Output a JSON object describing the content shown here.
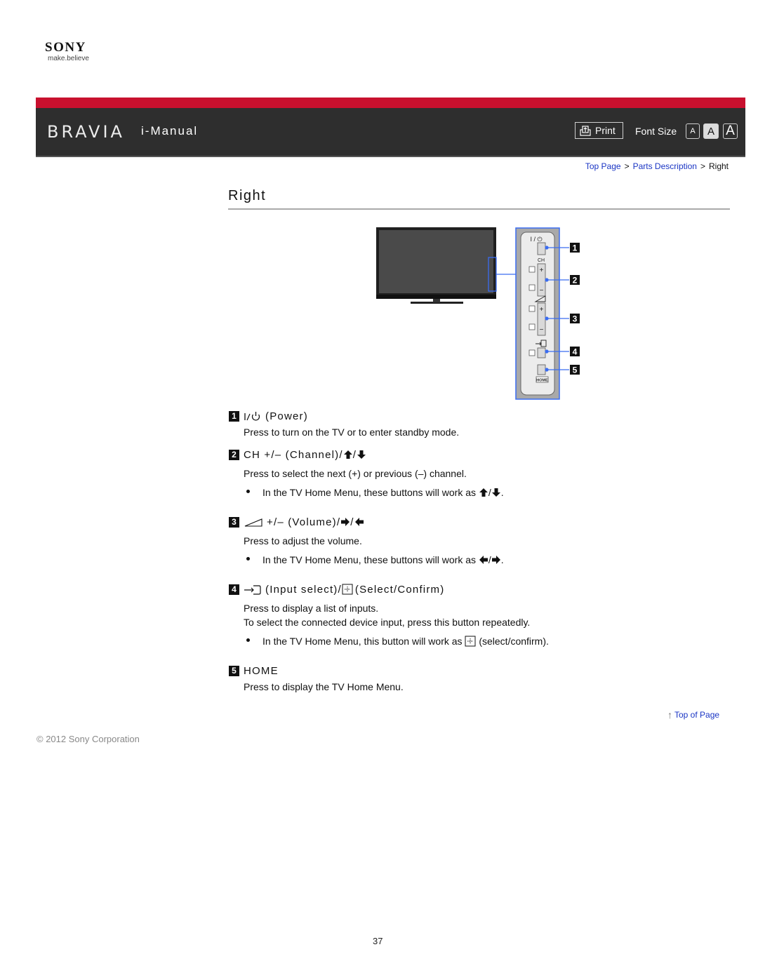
{
  "brand": {
    "logo": "SONY",
    "tagline": "make.believe"
  },
  "header": {
    "product": "BRAVIA",
    "manual": "i-Manual",
    "print_label": "Print",
    "font_size_label": "Font Size",
    "font_sizes": [
      "A",
      "A",
      "A"
    ],
    "font_size_selected": "medium",
    "colors": {
      "red_band": "#c8102e",
      "bar": "#2e2e2e"
    }
  },
  "breadcrumb": {
    "items": [
      "Top Page",
      "Parts Description"
    ],
    "separator": ">",
    "current": "Right"
  },
  "page": {
    "title": "Right",
    "page_number": "37"
  },
  "illustration": {
    "callouts": [
      "1",
      "2",
      "3",
      "4",
      "5"
    ],
    "labels": {
      "power": "I / ⏻",
      "ch": "CH",
      "home": "HOME"
    }
  },
  "sections": [
    {
      "number": "1",
      "icon": "power-icon",
      "heading": "(Power)",
      "lines": [
        "Press to turn on the TV or to enter standby mode."
      ],
      "bullets": []
    },
    {
      "number": "2",
      "icon": "",
      "heading": "CH +/– (Channel)/",
      "heading_icons": [
        "arrow-up-icon",
        "arrow-down-icon"
      ],
      "lines": [
        "Press to select the next (+) or previous (–) channel."
      ],
      "bullets": [
        {
          "text": "In the TV Home Menu, these buttons will work as",
          "icons": [
            "arrow-up-icon",
            "arrow-down-icon"
          ],
          "after": "."
        }
      ]
    },
    {
      "number": "3",
      "icon": "volume-icon",
      "heading": "+/– (Volume)/",
      "heading_icons": [
        "arrow-right-icon",
        "arrow-left-icon"
      ],
      "lines": [
        "Press to adjust the volume."
      ],
      "bullets": [
        {
          "text": "In the TV Home Menu, these buttons will work as",
          "icons": [
            "arrow-left-icon",
            "arrow-right-icon"
          ],
          "after": "."
        }
      ]
    },
    {
      "number": "4",
      "icon": "input-select-icon",
      "heading": "(Input select)/",
      "heading_2": "(Select/Confirm)",
      "lines": [
        "Press to display a list of inputs.",
        "To select the connected device input, press this button repeatedly."
      ],
      "bullets": [
        {
          "text": "In the TV Home Menu, this button will work as",
          "icons": [
            "select-confirm-icon"
          ],
          "after": "(select/confirm)."
        }
      ]
    },
    {
      "number": "5",
      "icon": "",
      "heading": "HOME",
      "lines": [
        "Press to display the TV Home Menu."
      ],
      "bullets": []
    }
  ],
  "footer": {
    "top_of_page": "Top of Page",
    "copyright": "© 2012 Sony Corporation"
  }
}
